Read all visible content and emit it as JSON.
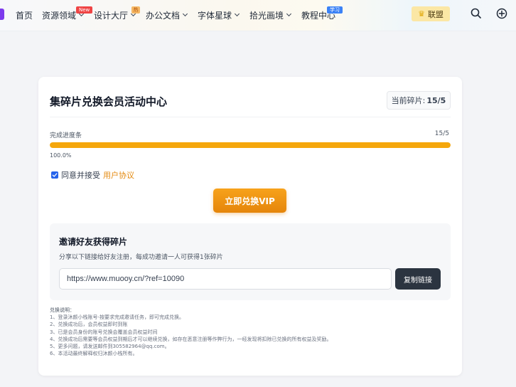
{
  "nav": {
    "items": [
      {
        "label": "首页"
      },
      {
        "label": "资源领域",
        "badge": "New"
      },
      {
        "label": "设计大厅",
        "badge": "热"
      },
      {
        "label": "办公文档"
      },
      {
        "label": "字体星球"
      },
      {
        "label": "拾光画境"
      },
      {
        "label": "教程中心",
        "badge": "学习"
      }
    ],
    "union_label": "联盟",
    "search_icon": "search-icon",
    "add_icon": "plus-circle-icon"
  },
  "card": {
    "title": "集碎片兑换会员活动中心",
    "shards_label": "当前碎片:",
    "shards_value": "15/5",
    "progress": {
      "label": "完成进度条",
      "count": "15/5",
      "percent_text": "100.0%",
      "fraction": 1.0
    },
    "agree_text": "同意并接受",
    "agree_link": "用户协议",
    "agree_checked": true,
    "vip_button": "立即兑换VIP",
    "invite": {
      "title": "邀请好友获得碎片",
      "desc": "分享以下链接给好友注册，每成功邀请一人可获得1张碎片",
      "link": "https://www.muooy.cn/?ref=10090",
      "copy_button": "复制链接"
    },
    "rules": {
      "title": "兑换说明：",
      "items": [
        "1、登录沐颜小栈账号-按要求完成邀请任务，即可完成兑换。",
        "2、兑换成功后，会员权益即时到账",
        "3、已是会员身份的账号兑换会覆盖会员权益时间",
        "4、兑换成功后需要等会员权益到期后才可以继续兑换，如存在恶意注册等作弊行为，一经发现将扣除已兑换的所有权益及奖励。",
        "5、更多问题，请发送邮件到305582964@qq.com。",
        "6、本活动最终解释权归沐颜小栈所有。"
      ]
    }
  },
  "colors": {
    "accent": "#f5a70c",
    "link": "#e48a10",
    "dark_button": "#2b3440"
  }
}
